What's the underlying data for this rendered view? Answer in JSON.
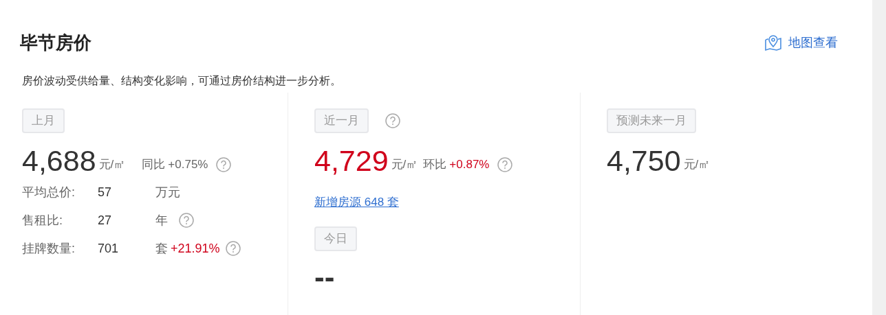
{
  "title": "毕节房价",
  "map_link": "地图查看",
  "description": "房价波动受供给量、结构变化影响，可通过房价结构进一步分析。",
  "columns": [
    {
      "tag": "上月",
      "tag_help": false,
      "price": "4,688",
      "price_highlight": false,
      "unit": "元/㎡",
      "change": {
        "label": "同比",
        "value": "+0.75%",
        "highlight": false,
        "help": true
      },
      "stats": [
        {
          "label": "平均总价:",
          "value": "57",
          "unit": "万元",
          "help": false
        },
        {
          "label": "售租比:",
          "value": "27",
          "unit": "年",
          "help": true
        },
        {
          "label": "挂牌数量:",
          "value": "701",
          "unit": "套",
          "change": "+21.91%",
          "help": true
        }
      ]
    },
    {
      "tag": "近一月",
      "tag_help": true,
      "price": "4,729",
      "price_highlight": true,
      "unit": "元/㎡",
      "change": {
        "label": "环比",
        "value": "+0.87%",
        "highlight": true,
        "help": true
      },
      "link": "新增房源 648 套",
      "sub": {
        "tag": "今日",
        "price": "--"
      }
    },
    {
      "tag": "预测未来一月",
      "tag_help": false,
      "price": "4,750",
      "price_highlight": false,
      "unit": "元/㎡"
    }
  ]
}
